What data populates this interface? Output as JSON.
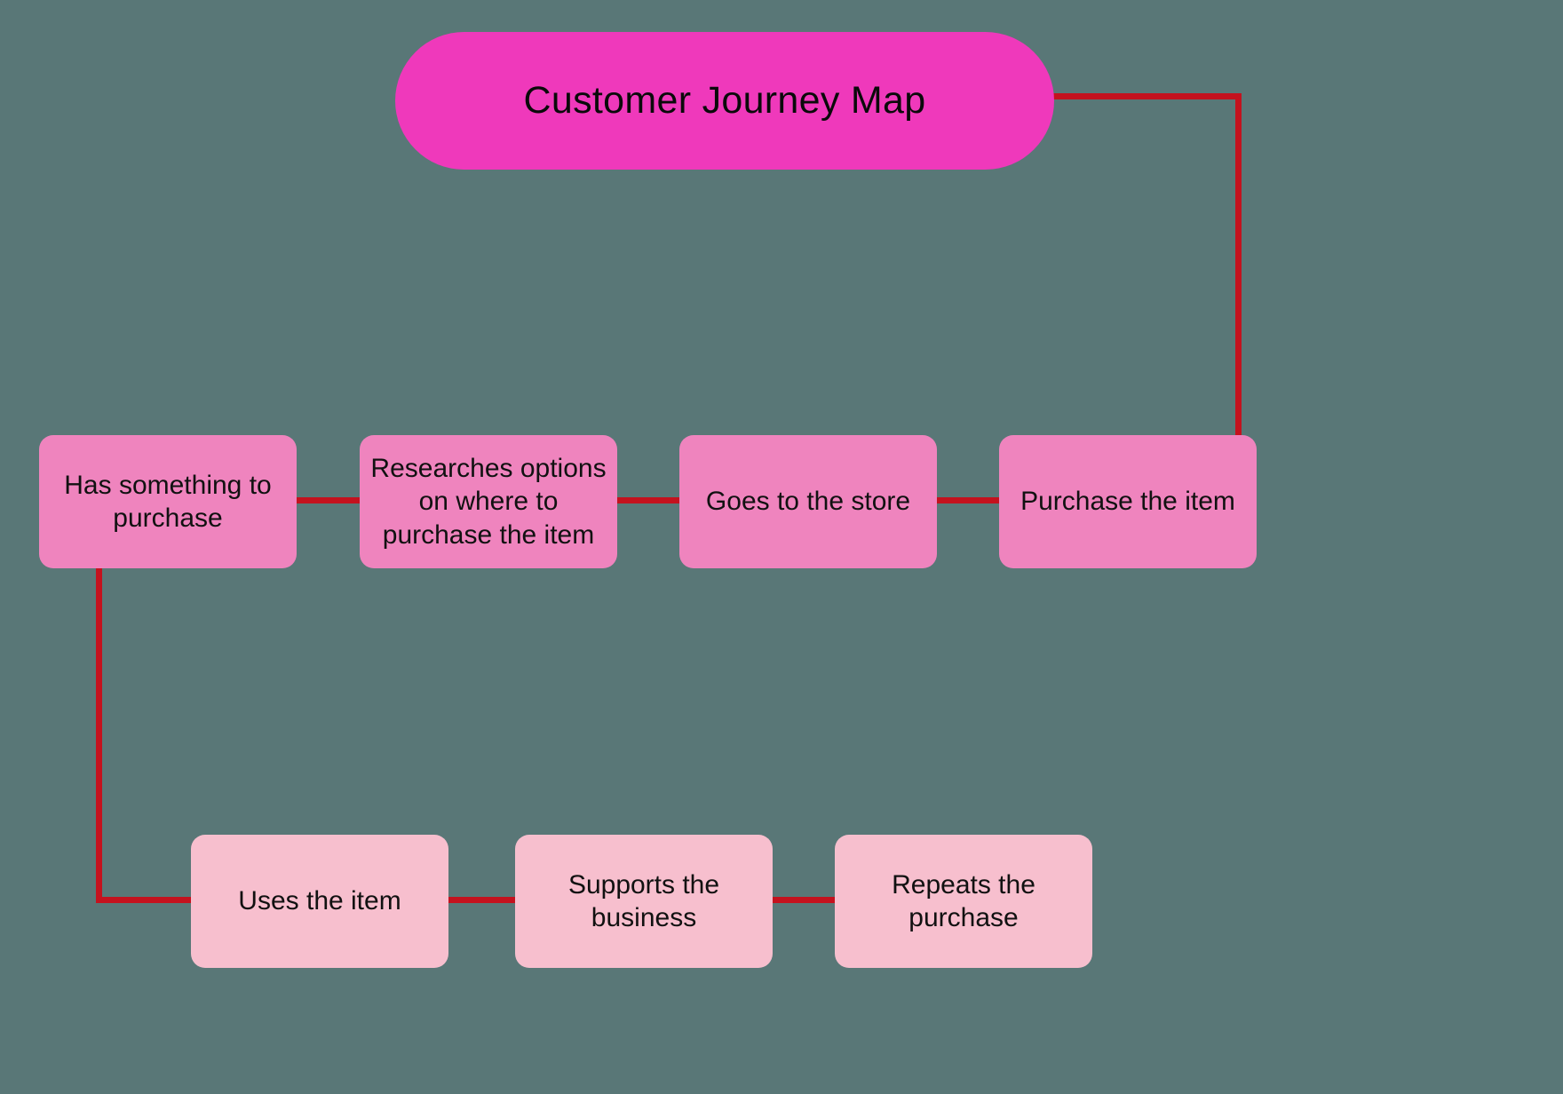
{
  "title": "Customer Journey Map",
  "steps": {
    "s1": "Has something to purchase",
    "s2": "Researches options on where to purchase the item",
    "s3": "Goes to the store",
    "s4": "Purchase the item",
    "s5": "Uses the item",
    "s6": "Supports the business",
    "s7": "Repeats the purchase"
  },
  "colors": {
    "background": "#597777",
    "connector": "#c4121e",
    "title_fill": "#ef39bb",
    "step_dark": "#ef84be",
    "step_light": "#f7bfce"
  }
}
